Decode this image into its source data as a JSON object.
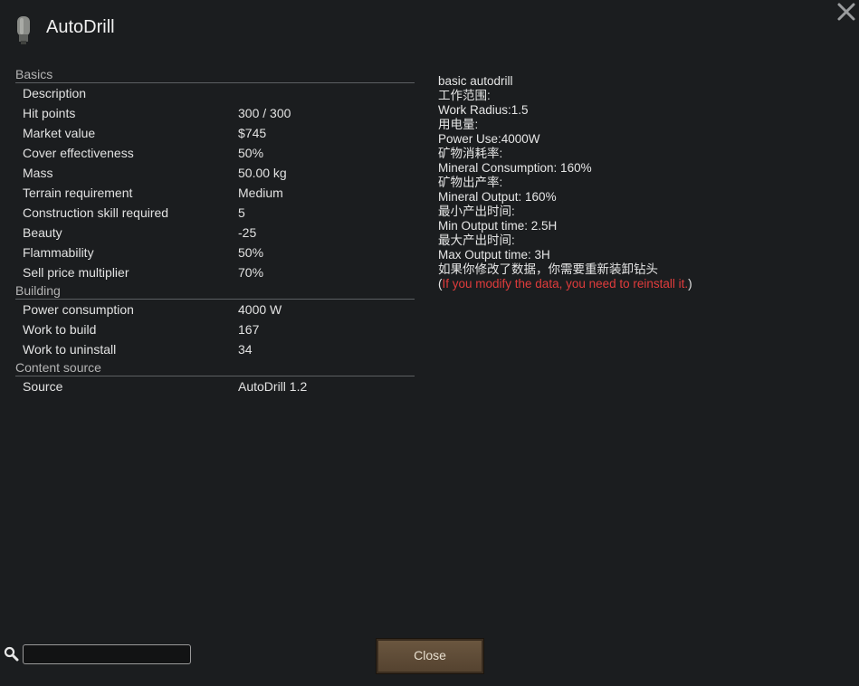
{
  "window": {
    "title": "AutoDrill"
  },
  "icons": {
    "thing": "drill-head-icon",
    "close": "close-x-icon",
    "search": "magnifier-icon"
  },
  "sections": [
    {
      "header": "Basics",
      "rows": [
        {
          "label": "Description",
          "value": ""
        },
        {
          "label": "Hit points",
          "value": "300 / 300"
        },
        {
          "label": "Market value",
          "value": "$745"
        },
        {
          "label": "Cover effectiveness",
          "value": "50%"
        },
        {
          "label": "Mass",
          "value": "50.00 kg"
        },
        {
          "label": "Terrain requirement",
          "value": "Medium"
        },
        {
          "label": "Construction skill required",
          "value": "5"
        },
        {
          "label": "Beauty",
          "value": "-25"
        },
        {
          "label": "Flammability",
          "value": "50%"
        },
        {
          "label": "Sell price multiplier",
          "value": "70%"
        }
      ]
    },
    {
      "header": "Building",
      "rows": [
        {
          "label": "Power consumption",
          "value": "4000 W"
        },
        {
          "label": "Work to build",
          "value": "167"
        },
        {
          "label": "Work to uninstall",
          "value": "34"
        }
      ]
    },
    {
      "header": "Content source",
      "rows": [
        {
          "label": "Source",
          "value": "AutoDrill 1.2"
        }
      ]
    }
  ],
  "description": {
    "lines": [
      "basic autodrill",
      "工作范围:",
      "Work Radius:1.5",
      "用电量:",
      "Power Use:4000W",
      "矿物消耗率:",
      "Mineral Consumption: 160%",
      "矿物出产率:",
      "Mineral Output: 160%",
      "最小产出时间:",
      "Min Output time: 2.5H",
      "最大产出时间:",
      "Max Output time: 3H",
      "如果你修改了数据，你需要重新装卸钻头"
    ],
    "warning_open": "(",
    "warning": "If you modify the data, you need to reinstall it.",
    "warning_close": ")"
  },
  "search": {
    "value": "",
    "placeholder": ""
  },
  "buttons": {
    "close": "Close"
  },
  "colors": {
    "background": "#1b1d1f",
    "warning": "#e03c3c",
    "button": "#5f4c37"
  }
}
